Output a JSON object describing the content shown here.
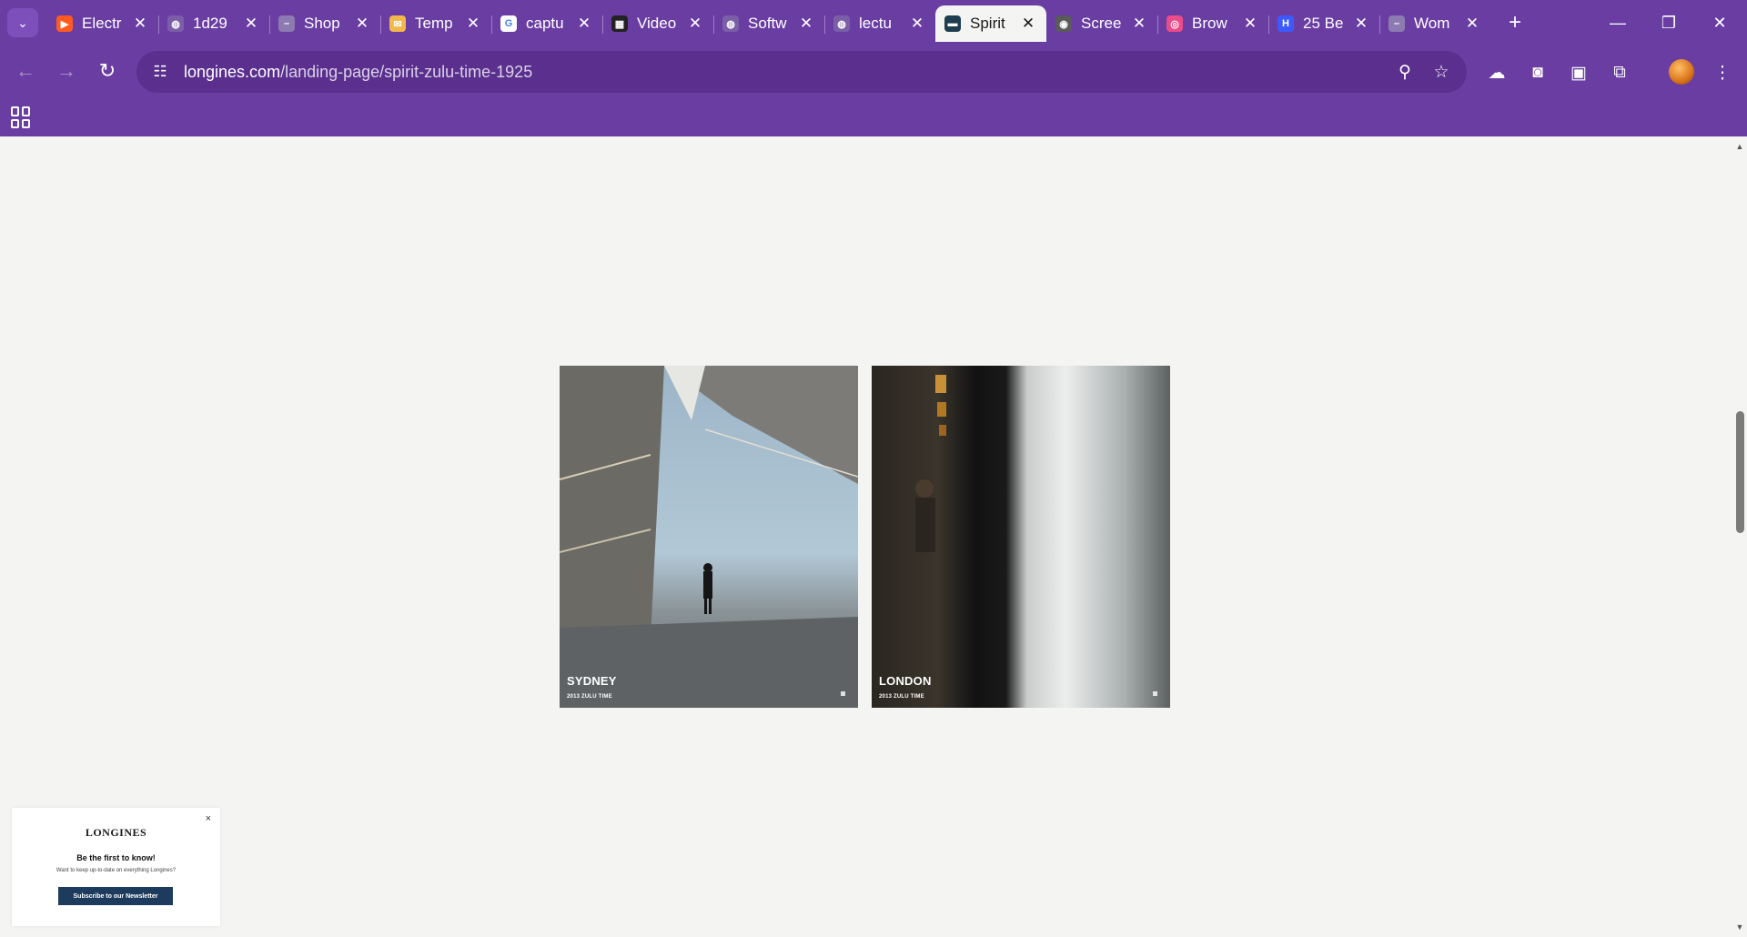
{
  "browser": {
    "tabs": [
      {
        "title": "Electr",
        "favicon": "orange-flag-icon",
        "color": "#ff5a1f",
        "glyph": "▶"
      },
      {
        "title": "1d29",
        "favicon": "globe-icon",
        "color": "#7a5fa8",
        "glyph": "◍"
      },
      {
        "title": "Shop",
        "favicon": "dash-icon",
        "color": "#8c7bb0",
        "glyph": "–"
      },
      {
        "title": "Temp",
        "favicon": "envelope-icon",
        "color": "#f2b84b",
        "glyph": "✉"
      },
      {
        "title": "captu",
        "favicon": "google-icon",
        "color": "#ffffff",
        "glyph": "G"
      },
      {
        "title": "Video",
        "favicon": "film-icon",
        "color": "#222222",
        "glyph": "▦"
      },
      {
        "title": "Softw",
        "favicon": "globe-icon",
        "color": "#7a5fa8",
        "glyph": "◍"
      },
      {
        "title": "lectu",
        "favicon": "globe-icon",
        "color": "#7a5fa8",
        "glyph": "◍"
      },
      {
        "title": "Spirit",
        "favicon": "longines-icon",
        "color": "#1e3d4f",
        "glyph": "▬",
        "active": true
      },
      {
        "title": "Scree",
        "favicon": "camera-icon",
        "color": "#5a5a5a",
        "glyph": "◉"
      },
      {
        "title": "Brow",
        "favicon": "dribbble-icon",
        "color": "#ea4c89",
        "glyph": "◎"
      },
      {
        "title": "25 Be",
        "favicon": "h-logo-icon",
        "color": "#3d5afe",
        "glyph": "H"
      },
      {
        "title": "Wom",
        "favicon": "dash-icon",
        "color": "#8c7bb0",
        "glyph": "–"
      }
    ],
    "url_domain": "longines.com",
    "url_path": "/landing-page/spirit-zulu-time-1925"
  },
  "page": {
    "cards": [
      {
        "city": "SYDNEY",
        "subtitle": "2013 ZULU TIME"
      },
      {
        "city": "LONDON",
        "subtitle": "2013 ZULU TIME"
      }
    ],
    "newsletter": {
      "logo": "LONGINES",
      "close": "×",
      "title": "Be the first to know!",
      "text": "Want to keep up-to-date on everything Longines?",
      "button": "Subscribe to our Newsletter"
    }
  }
}
